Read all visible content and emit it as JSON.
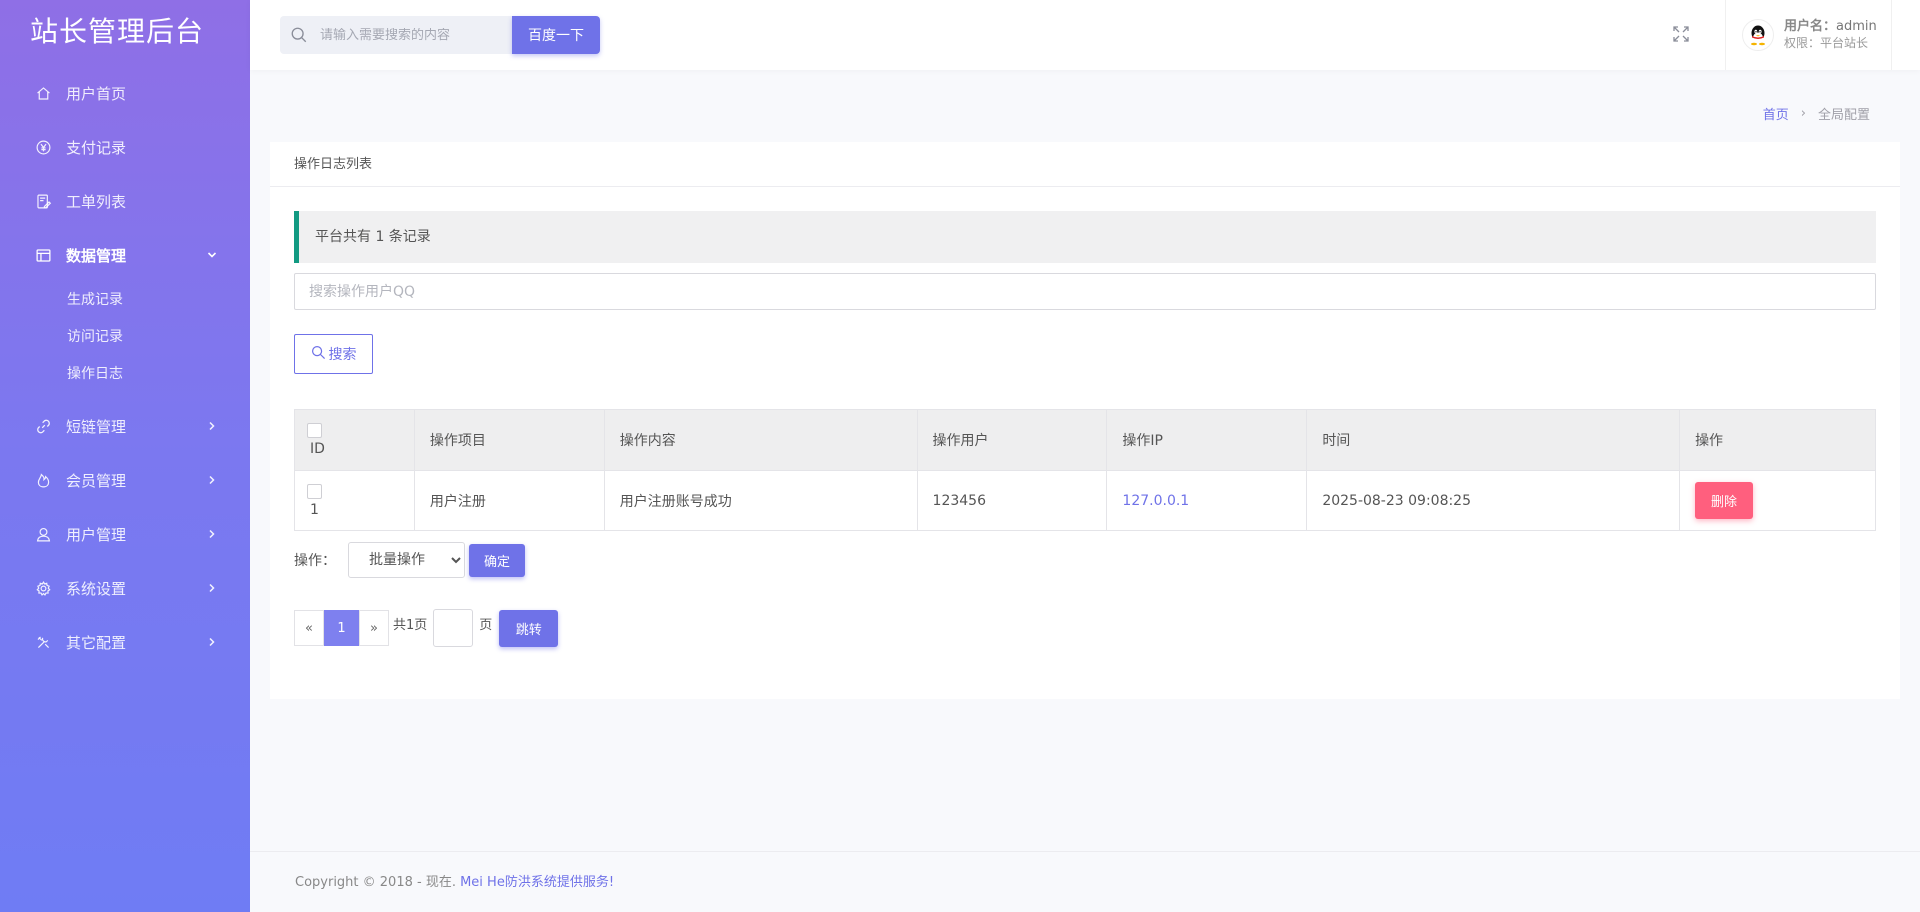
{
  "app": {
    "title": "站长管理后台"
  },
  "header": {
    "search_placeholder": "请输入需要搜索的内容",
    "search_button": "百度一下",
    "user_label": "用户名：",
    "user_name": "admin",
    "role": "权限：平台站长"
  },
  "sidebar": {
    "items": [
      {
        "label": "用户首页",
        "icon": "home-icon"
      },
      {
        "label": "支付记录",
        "icon": "yen-icon"
      },
      {
        "label": "工单列表",
        "icon": "ticket-icon"
      },
      {
        "label": "数据管理",
        "icon": "table-icon",
        "open": true,
        "sub": [
          "生成记录",
          "访问记录",
          "操作日志"
        ]
      },
      {
        "label": "短链管理",
        "icon": "link-icon"
      },
      {
        "label": "会员管理",
        "icon": "fire-icon"
      },
      {
        "label": "用户管理",
        "icon": "user-icon"
      },
      {
        "label": "系统设置",
        "icon": "gear-icon"
      },
      {
        "label": "其它配置",
        "icon": "tools-icon"
      }
    ]
  },
  "breadcrumb": {
    "home": "首页",
    "separator": "›",
    "current": "全局配置"
  },
  "card": {
    "title": "操作日志列表",
    "notice": "平台共有 1 条记录",
    "qq_placeholder": "搜索操作用户QQ",
    "search_button": "搜索"
  },
  "table": {
    "headers": [
      "ID",
      "操作项目",
      "操作内容",
      "操作用户",
      "操作IP",
      "时间",
      "操作"
    ],
    "rows": [
      {
        "id": "1",
        "item": "用户注册",
        "content": "用户注册账号成功",
        "user": "123456",
        "ip": "127.0.0.1",
        "time": "2025-08-23 09:08:25",
        "action": "删除"
      }
    ]
  },
  "batch": {
    "label": "操作：",
    "select_value": "批量操作",
    "confirm": "确定"
  },
  "pager": {
    "prev": "«",
    "current": "1",
    "next": "»",
    "total": "共1页",
    "unit": "页",
    "jump": "跳转"
  },
  "footer": {
    "text": "Copyright © 2018 - 现在. ",
    "brand": "Mei He防洪系统提供服务!"
  },
  "colors": {
    "accent": "#6f72e8",
    "danger": "#ff5f7e",
    "notice_border": "#129a82",
    "sidebar_top": "#8f6fe6",
    "sidebar_bottom": "#6f7cf4"
  }
}
